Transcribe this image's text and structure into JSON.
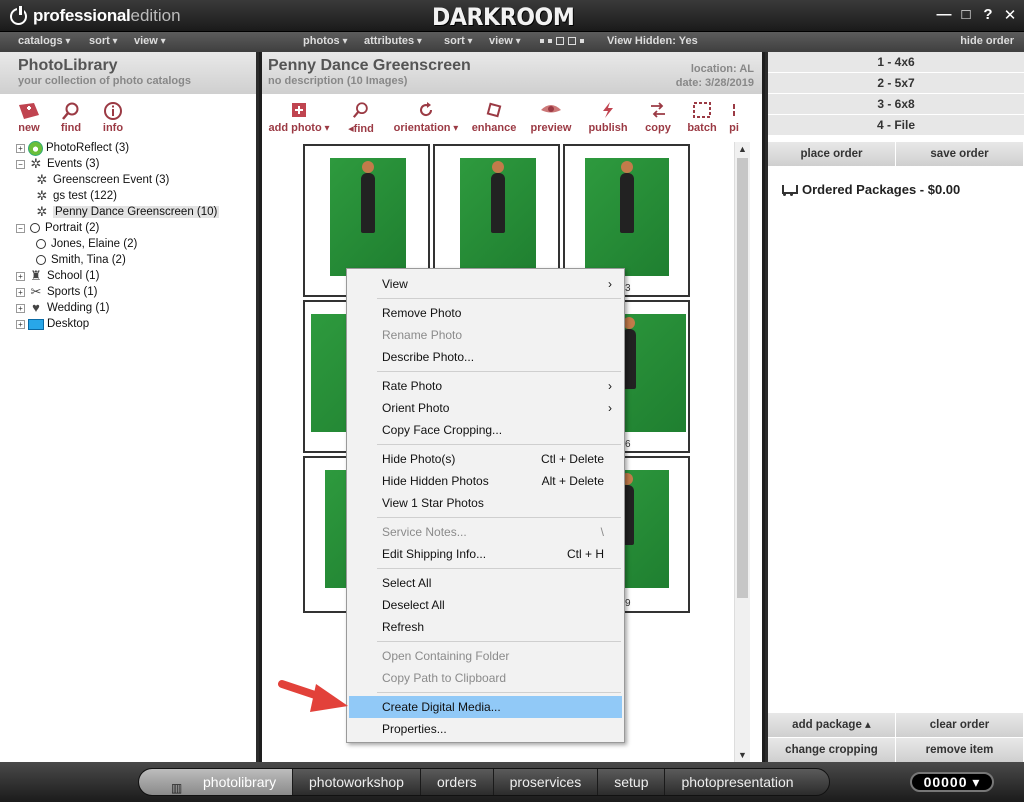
{
  "app": {
    "logo_strong": "professional",
    "logo_light": "edition",
    "brand": "DARKROOM",
    "winctl": [
      "—",
      "□",
      "?",
      "✕"
    ]
  },
  "menubar": {
    "catalogs": "catalogs",
    "sort": "sort",
    "view": "view",
    "photos": "photos",
    "attributes": "attributes",
    "sort2": "sort",
    "view2": "view",
    "view_hidden": "View Hidden: Yes",
    "hide_order": "hide order"
  },
  "library": {
    "title": "PhotoLibrary",
    "subtitle": "your collection of photo catalogs",
    "tools": [
      "new",
      "find",
      "info"
    ],
    "tree": [
      {
        "label": "PhotoReflect (3)",
        "level": 0,
        "exp": "+",
        "icon": "photoreflect-icon"
      },
      {
        "label": "Events (3)",
        "level": 0,
        "exp": "−",
        "icon": "events-icon"
      },
      {
        "label": "Greenscreen Event (3)",
        "level": 1,
        "icon": "event-icon"
      },
      {
        "label": "gs test (122)",
        "level": 1,
        "icon": "event-icon"
      },
      {
        "label": "Penny Dance Greenscreen (10)",
        "level": 1,
        "icon": "event-icon",
        "selected": true
      },
      {
        "label": "Portrait (2)",
        "level": 0,
        "exp": "−",
        "icon": "portrait-icon"
      },
      {
        "label": "Jones, Elaine (2)",
        "level": 1,
        "icon": "person-icon"
      },
      {
        "label": "Smith, Tina (2)",
        "level": 1,
        "icon": "person-icon"
      },
      {
        "label": "School (1)",
        "level": 0,
        "exp": "+",
        "icon": "school-icon"
      },
      {
        "label": "Sports (1)",
        "level": 0,
        "exp": "+",
        "icon": "sports-icon"
      },
      {
        "label": "Wedding (1)",
        "level": 0,
        "exp": "+",
        "icon": "wedding-icon"
      },
      {
        "label": "Desktop",
        "level": 0,
        "exp": "+",
        "icon": "desktop-icon"
      }
    ]
  },
  "catalog": {
    "title": "Penny Dance Greenscreen",
    "subtitle": "no description (10 Images)",
    "location": "location: AL",
    "date": "date: 3/28/2019",
    "tools": [
      {
        "label": "add photo",
        "caret": true
      },
      {
        "label": "find",
        "prefix": true
      },
      {
        "label": "orientation",
        "caret": true
      },
      {
        "label": "enhance"
      },
      {
        "label": "preview"
      },
      {
        "label": "publish"
      },
      {
        "label": "copy"
      },
      {
        "label": "batch"
      },
      {
        "label": "pi"
      }
    ],
    "thumb_labels": [
      "3",
      "6",
      "9"
    ]
  },
  "order": {
    "sizes": [
      "1 - 4x6",
      "2 - 5x7",
      "3 - 6x8",
      "4 - File"
    ],
    "place_order": "place order",
    "save_order": "save order",
    "ordered_packages": "Ordered Packages - $0.00",
    "add_package": "add package ▴",
    "clear_order": "clear order",
    "change_cropping": "change cropping",
    "remove_item": "remove item"
  },
  "context_menu": {
    "items": [
      {
        "label": "View",
        "sub": true
      },
      {
        "label": "Remove Photo"
      },
      {
        "label": "Rename Photo",
        "disabled": true
      },
      {
        "label": "Describe Photo..."
      },
      {
        "label": "Rate Photo",
        "sub": true
      },
      {
        "label": "Orient Photo",
        "sub": true
      },
      {
        "label": "Copy Face Cropping..."
      },
      {
        "label": "Hide Photo(s)",
        "shortcut": "Ctl + Delete"
      },
      {
        "label": "Hide Hidden Photos",
        "shortcut": "Alt + Delete"
      },
      {
        "label": "View 1 Star Photos"
      },
      {
        "label": "Service Notes...",
        "shortcut": "\\",
        "disabled": true
      },
      {
        "label": "Edit Shipping Info...",
        "shortcut": "Ctl + H"
      },
      {
        "label": "Select All"
      },
      {
        "label": "Deselect All"
      },
      {
        "label": "Refresh"
      },
      {
        "label": "Open Containing Folder",
        "disabled": true
      },
      {
        "label": "Copy Path to Clipboard",
        "disabled": true
      },
      {
        "label": "Create Digital Media...",
        "highlighted": true
      },
      {
        "label": "Properties..."
      }
    ]
  },
  "bottom_nav": {
    "tabs": [
      "photolibrary",
      "photoworkshop",
      "orders",
      "proservices",
      "setup",
      "photopresentation"
    ],
    "counter": "00000 ▾"
  },
  "colors": {
    "accent": "#9b3a44",
    "highlight": "#91c9f7",
    "green_screen": "#2e9a3e"
  }
}
